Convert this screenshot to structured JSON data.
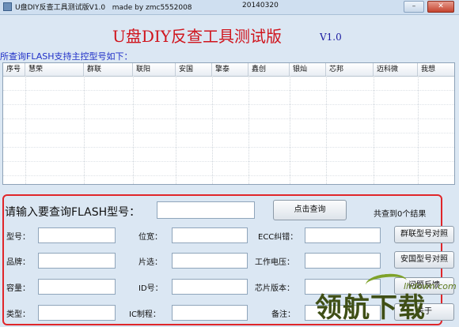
{
  "window": {
    "title": "U盘DIY反查工具测试版V1.0   made by zmc5552008",
    "date": "20140320",
    "min_label": "–",
    "close_label": "✕"
  },
  "header": {
    "title": "U盘DIY反查工具测试版",
    "version": "V1.0"
  },
  "supported": {
    "label": "所查询FLASH支持主控型号如下：",
    "columns": [
      "序号",
      "慧荣",
      "群联",
      "联阳",
      "安国",
      "擎泰",
      "鑫创",
      "银灿",
      "芯邦",
      "迈科微",
      "我想"
    ]
  },
  "query": {
    "prompt": "请输入要查询FLASH型号：",
    "input_value": "",
    "button": "点击查询",
    "result": "共查到0个结果"
  },
  "fields": {
    "model": "型号：",
    "brand": "品牌：",
    "capacity": "容量：",
    "type": "类型：",
    "width": "位宽：",
    "cs": "片选：",
    "id": "ID号：",
    "ic": "IC制程：",
    "ecc": "ECC纠错：",
    "voltage": "工作电压：",
    "chip_ver": "芯片版本：",
    "remark": "备注："
  },
  "side_buttons": {
    "phison": "群联型号对照",
    "alcor": "安国型号对照",
    "feedback": "问题反馈",
    "about": "关于"
  },
  "watermark": {
    "text": "领航下载",
    "url": "lhdown.com"
  },
  "colors": {
    "heading": "#d0141c",
    "label_blue": "#2030c8",
    "panel_border": "#e0262a",
    "window_bg": "#dbe7f3"
  }
}
